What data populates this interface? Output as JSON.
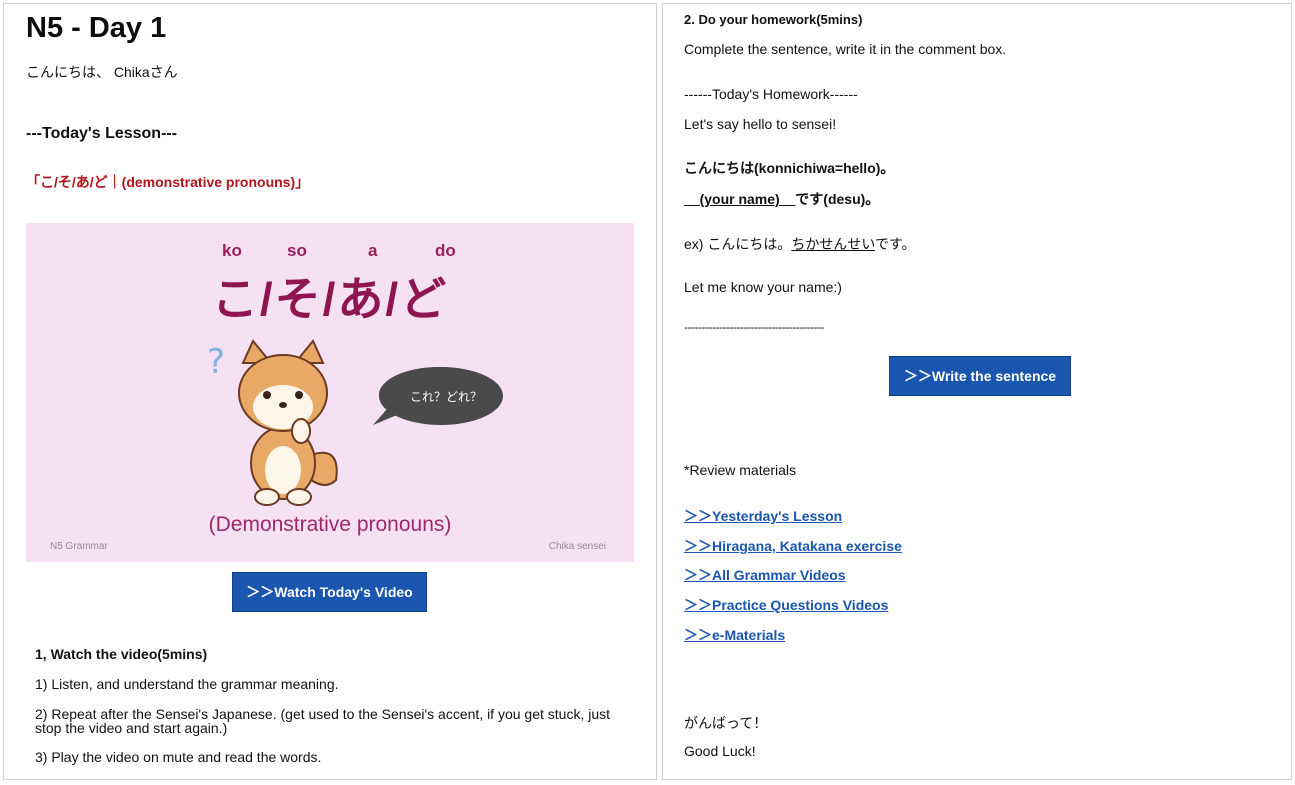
{
  "left": {
    "title": "N5 - Day 1",
    "greeting": "こんにちは、 Chikaさん",
    "lesson_heading": "---Today's Lesson---",
    "lesson_topic": "「こ/そ/あ/ど｜(demonstrative pronouns)」",
    "thumbnail": {
      "romaji": [
        "ko",
        "so",
        "a",
        "do"
      ],
      "kana": "こ/そ/あ/ど",
      "bubble": "これ？どれ？",
      "subtitle": "(Demonstrative pronouns)",
      "footer_left": "N5 Grammar",
      "footer_right": "Chika sensei",
      "colors": {
        "background": "#f5e1f3",
        "accent": "#8e1552"
      }
    },
    "watch_button": "＞＞Watch Today's Video",
    "step_heading": "1, Watch the video(5mins)",
    "steps": [
      "1) Listen, and understand the grammar meaning.",
      "2) Repeat after the Sensei's Japanese. (get used to the Sensei's accent, if you get stuck, just stop the video and start again.)",
      "3) Play the video on mute and read the words."
    ]
  },
  "right": {
    "homework_heading": "2. Do your homework(5mins)",
    "instruction": "Complete the sentence, write it in the comment box.",
    "hw_start": "------Today's Homework------",
    "hw_prompt": "Let's say hello to sensei!",
    "line1": "こんにちは(konnichiwa=hello)。",
    "line2_name": "__(your name)__",
    "line2_rest": "です(desu)。",
    "example_prefix": "ex) こんにちは。",
    "example_name": "ちかせんせい",
    "example_suffix": "です。",
    "name_prompt": "Let me know your name:)",
    "divider": "----------------------------------------",
    "write_button": "＞＞Write the sentence",
    "review_heading": "*Review materials",
    "links": [
      "＞＞Yesterday's Lesson",
      "＞＞Hiragana, Katakana exercise",
      "＞＞All Grammar Videos",
      "＞＞Practice Questions Videos",
      "＞＞e-Materials"
    ],
    "closing_jp": "がんばって！",
    "closing_en": "Good Luck!"
  },
  "colors": {
    "link": "#1a56b0",
    "button": "#1a56b0",
    "topic_red": "#b3141b"
  }
}
